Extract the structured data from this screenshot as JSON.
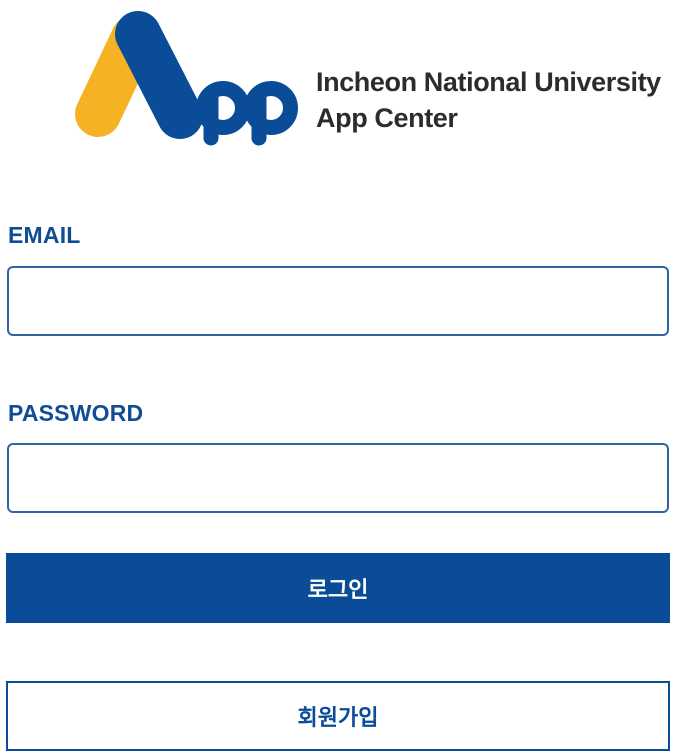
{
  "brand": {
    "line1": "Incheon National University",
    "line2": "App Center",
    "logo_icon": "app-logo-icon",
    "colors": {
      "blue": "#0a4c97",
      "yellow": "#f5b225"
    }
  },
  "form": {
    "email_label": "EMAIL",
    "email_value": "",
    "email_placeholder": "",
    "password_label": "PASSWORD",
    "password_value": "",
    "password_placeholder": "",
    "login_label": "로그인",
    "signup_label": "회원가입"
  },
  "colors": {
    "accent": "#0a4c97",
    "input_border": "#2f64a6",
    "label": "#0f4d97"
  }
}
